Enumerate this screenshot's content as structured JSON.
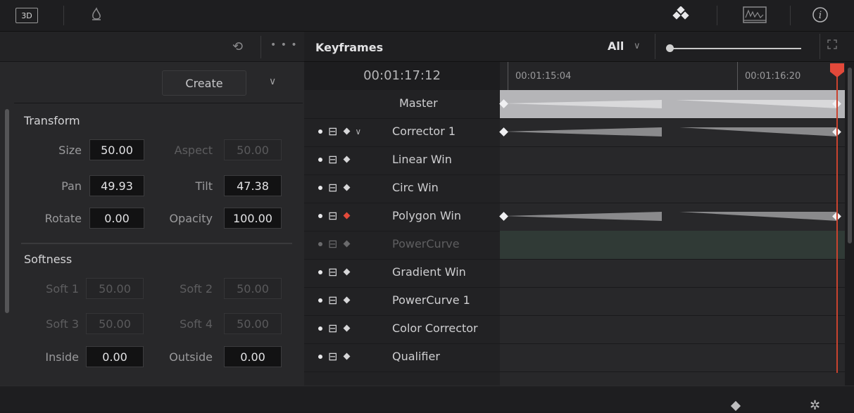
{
  "toolbar": {
    "btn_3d": "3D",
    "icons": [
      "3d-icon",
      "flame-icon",
      "keyframe-diamonds-icon",
      "scope-icon",
      "info-icon"
    ]
  },
  "left_panel": {
    "create_label": "Create",
    "transform": {
      "title": "Transform",
      "size_label": "Size",
      "size_value": "50.00",
      "aspect_label": "Aspect",
      "aspect_value": "50.00",
      "pan_label": "Pan",
      "pan_value": "49.93",
      "tilt_label": "Tilt",
      "tilt_value": "47.38",
      "rotate_label": "Rotate",
      "rotate_value": "0.00",
      "opacity_label": "Opacity",
      "opacity_value": "100.00"
    },
    "softness": {
      "title": "Softness",
      "soft1_label": "Soft 1",
      "soft1_value": "50.00",
      "soft2_label": "Soft 2",
      "soft2_value": "50.00",
      "soft3_label": "Soft 3",
      "soft3_value": "50.00",
      "soft4_label": "Soft 4",
      "soft4_value": "50.00",
      "inside_label": "Inside",
      "inside_value": "0.00",
      "outside_label": "Outside",
      "outside_value": "0.00"
    }
  },
  "keyframes": {
    "title": "Keyframes",
    "filter": "All",
    "timecode": "00:01:17:12",
    "ruler_labels": [
      "00:01:15:04",
      "00:01:16:20"
    ],
    "tracks": [
      {
        "name": "Master"
      },
      {
        "name": "Corrector 1"
      },
      {
        "name": "Linear Win"
      },
      {
        "name": "Circ Win"
      },
      {
        "name": "Polygon Win"
      },
      {
        "name": "PowerCurve"
      },
      {
        "name": "Gradient Win"
      },
      {
        "name": "PowerCurve 1"
      },
      {
        "name": "Color Corrector"
      },
      {
        "name": "Qualifier"
      }
    ]
  },
  "colors": {
    "playhead": "#e2493a",
    "keyframe_red": "#e34a3a"
  }
}
